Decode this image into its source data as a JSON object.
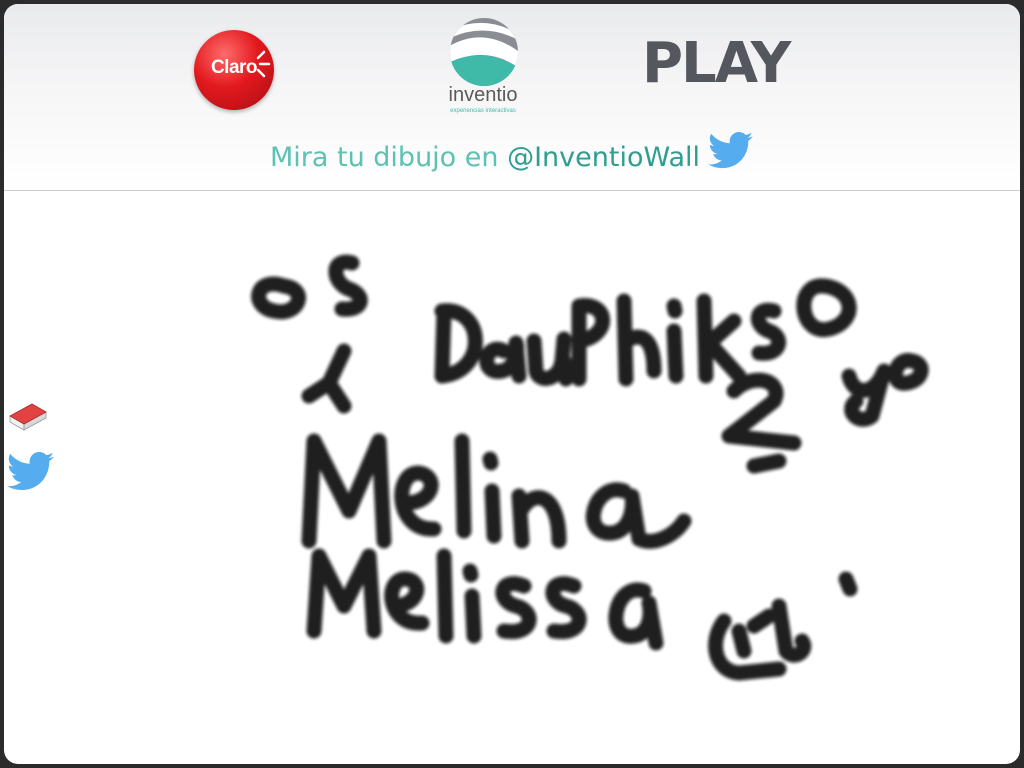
{
  "header": {
    "sponsor_logo_text": "Claro",
    "brand_logo_name": "inventio",
    "brand_logo_tagline": "experiencias interactivas",
    "partner_logo_text": "PLAY",
    "tagline_lead": "Mira tu dibujo en ",
    "tagline_handle": "@InventioWall",
    "twitter_icon": "twitter-bird-icon"
  },
  "toolbar": {
    "tools": [
      {
        "name": "eraser-icon"
      },
      {
        "name": "twitter-bird-icon"
      }
    ]
  },
  "canvas": {
    "ink_color": "#111111",
    "background": "#ffffff"
  },
  "colors": {
    "claro_red": "#e2191e",
    "inventio_teal": "#3fb9a8",
    "tagline_teal": "#5cc2b4",
    "twitter_blue": "#55acee",
    "play_gray": "#55575f"
  }
}
